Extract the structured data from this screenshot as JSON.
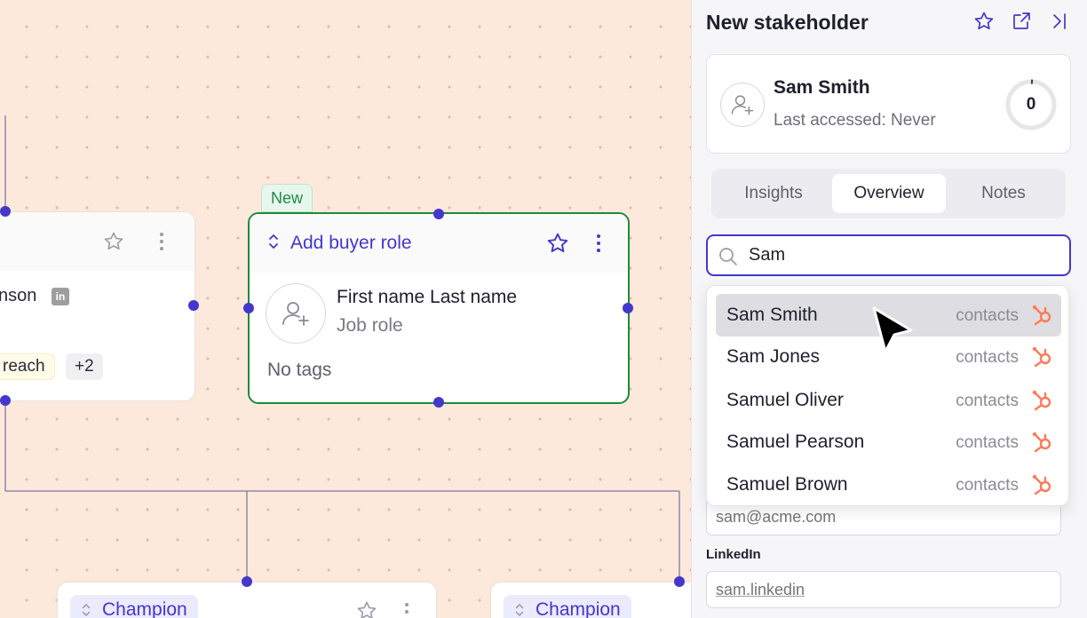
{
  "canvas": {
    "left_card": {
      "partial_name": "nson",
      "tags": [
        "reach",
        "+2"
      ]
    },
    "new_card": {
      "badge": "New",
      "role_label": "Add buyer role",
      "first_last": "First name Last name",
      "job_role": "Job role",
      "tags_text": "No tags"
    },
    "bottom_cards": [
      {
        "role_label": "Champion"
      },
      {
        "role_label": "Champion"
      }
    ]
  },
  "panel": {
    "title": "New stakeholder",
    "profile": {
      "name": "Sam Smith",
      "last_accessed": "Last accessed: Never",
      "score": "0"
    },
    "tabs": [
      {
        "label": "Insights",
        "active": false
      },
      {
        "label": "Overview",
        "active": true
      },
      {
        "label": "Notes",
        "active": false
      }
    ],
    "search": {
      "value": "Sam"
    },
    "results": [
      {
        "name": "Sam Smith",
        "source": "contacts",
        "icon": "hubspot-icon",
        "highlighted": true
      },
      {
        "name": "Sam Jones",
        "source": "contacts",
        "icon": "hubspot-icon",
        "highlighted": false
      },
      {
        "name": "Samuel Oliver",
        "source": "contacts",
        "icon": "hubspot-icon",
        "highlighted": false
      },
      {
        "name": "Samuel Pearson",
        "source": "contacts",
        "icon": "hubspot-icon",
        "highlighted": false
      },
      {
        "name": "Samuel Brown",
        "source": "contacts",
        "icon": "hubspot-icon",
        "highlighted": false
      }
    ],
    "email_placeholder": "sam@acme.com",
    "linkedin_label": "LinkedIn",
    "linkedin_placeholder": "sam.linkedin"
  },
  "colors": {
    "accent": "#4338ca",
    "canvas_bg": "#fde8dc",
    "new_green": "#1f8a3a",
    "hubspot_orange": "#ff7a59"
  }
}
